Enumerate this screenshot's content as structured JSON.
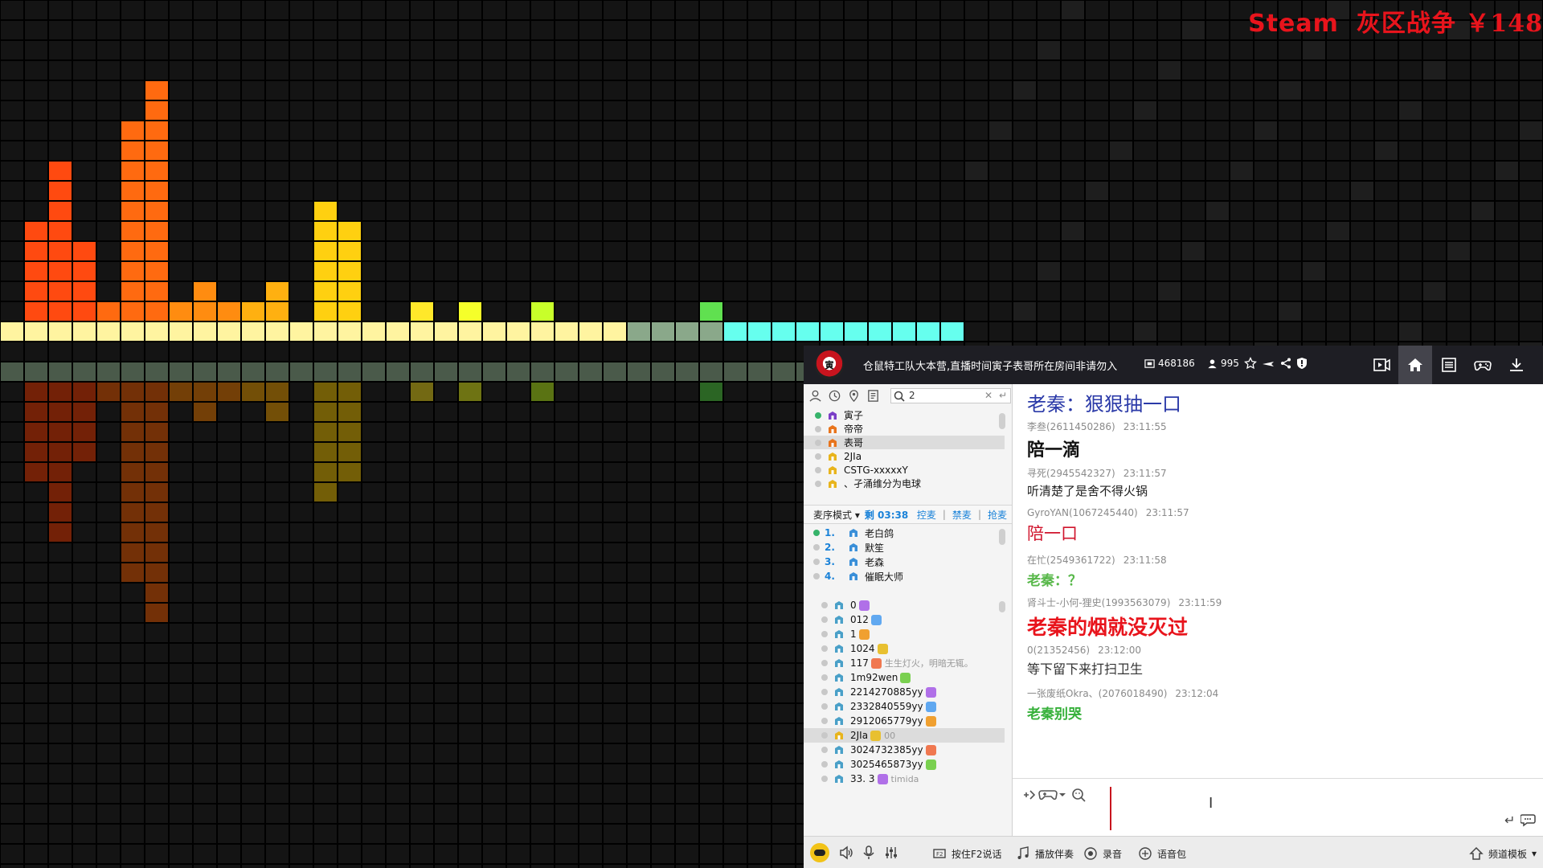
{
  "overlay": {
    "brand": "Steam",
    "text": "灰区战争 ￥148",
    "color": "#e8141c"
  },
  "visualizer": {
    "colors": [
      "#ff4a10",
      "#ff6a10",
      "#ff8c10",
      "#ffb010",
      "#ffd010",
      "#ffe82a",
      "#f5ff2a",
      "#c8ff2a",
      "#9cff2a",
      "#60e050",
      "#40d090",
      "#40e0c0",
      "#40f0e0"
    ]
  },
  "titlebar": {
    "channel_title": "仓鼠特工队大本营,直播时间寅子表哥所在房间非请勿入",
    "channel_id": "468186",
    "online_count": "995",
    "icons": [
      "star-icon",
      "plane-icon",
      "share-icon",
      "shield-icon",
      "video-icon",
      "home-icon",
      "list-icon",
      "gamepad-icon",
      "download-icon"
    ]
  },
  "left_panel": {
    "search_value": "2",
    "channel_users": [
      {
        "name": "寅子",
        "online": true,
        "color": "#7b3fc7"
      },
      {
        "name": "帝帝",
        "online": false,
        "color": "#e8741c"
      },
      {
        "name": "表哥",
        "online": false,
        "color": "#e8741c",
        "selected": true
      },
      {
        "name": "2JIa",
        "online": false,
        "color": "#e8b41c"
      },
      {
        "name": "CSTG-xxxxxY",
        "online": false,
        "color": "#e8b41c"
      },
      {
        "name": "、孑涌维分为电球",
        "online": false,
        "color": "#e8b41c"
      }
    ],
    "mic_bar": {
      "mode": "麦序模式",
      "time": "剩 03:38",
      "links": [
        "控麦",
        "禁麦",
        "抢麦"
      ]
    },
    "mic_queue": [
      {
        "num": "1.",
        "name": "老白鸽",
        "online": true
      },
      {
        "num": "2.",
        "name": "默笙",
        "online": false
      },
      {
        "num": "3.",
        "name": "老森",
        "online": false
      },
      {
        "num": "4.",
        "name": "催眠大师",
        "online": false
      }
    ],
    "members": [
      {
        "name": "0",
        "extra": ""
      },
      {
        "name": "012",
        "extra": ""
      },
      {
        "name": "1",
        "extra": ""
      },
      {
        "name": "1024",
        "extra": ""
      },
      {
        "name": "117",
        "extra": "生生灯火，明暗无辄。"
      },
      {
        "name": "1m92wen",
        "extra": ""
      },
      {
        "name": "2214270885yy",
        "extra": ""
      },
      {
        "name": "2332840559yy",
        "extra": ""
      },
      {
        "name": "2912065779yy",
        "extra": ""
      },
      {
        "name": "2JIa",
        "extra": "00",
        "selected": true
      },
      {
        "name": "3024732385yy",
        "extra": ""
      },
      {
        "name": "3025465873yy",
        "extra": ""
      },
      {
        "name": "33. 3",
        "extra": "timida"
      }
    ]
  },
  "chat": {
    "messages": [
      {
        "sender": "",
        "time": "",
        "text": "老秦：狠狠抽一口",
        "color": "#2b3aa8",
        "size": 24,
        "bold": false,
        "serif": true
      },
      {
        "sender": "李叁(2611450286)",
        "time": "23:11:55",
        "text": "陪一滴",
        "color": "#111111",
        "size": 22,
        "bold": true,
        "serif": false
      },
      {
        "sender": "寻死(2945542327)",
        "time": "23:11:57",
        "text": "听清楚了是舍不得火锅",
        "color": "#222222",
        "size": 15,
        "bold": false,
        "serif": false
      },
      {
        "sender": "GyroYAN(1067245440)",
        "time": "23:11:57",
        "text": "陪一口",
        "color": "#d0142c",
        "size": 21,
        "bold": false,
        "serif": true
      },
      {
        "sender": "在忙(2549361722)",
        "time": "23:11:58",
        "text": "老秦：？",
        "color": "#58b84a",
        "size": 17,
        "bold": true,
        "serif": true
      },
      {
        "sender": "肾斗士-小何-狸史(1993563079)",
        "time": "23:11:59",
        "text": "老秦的烟就没灭过",
        "color": "#e8141c",
        "size": 25,
        "bold": true,
        "serif": false
      },
      {
        "sender": "0(21352456)",
        "time": "23:12:00",
        "text": "等下留下来打扫卫生",
        "color": "#333333",
        "size": 16,
        "bold": false,
        "serif": true
      },
      {
        "sender": "一张废纸Okra、(2076018490)",
        "time": "23:12:04",
        "text": "老秦别哭",
        "color": "#36b03a",
        "size": 17,
        "bold": true,
        "serif": false
      }
    ]
  },
  "bottom_bar": {
    "buttons": [
      {
        "label": "按住F2说话",
        "icon": "keyboard-icon"
      },
      {
        "label": "播放伴奏",
        "icon": "music-icon"
      },
      {
        "label": "录音",
        "icon": "record-icon"
      },
      {
        "label": "语音包",
        "icon": "voice-pack-icon"
      }
    ],
    "template_label": "频道模板"
  }
}
